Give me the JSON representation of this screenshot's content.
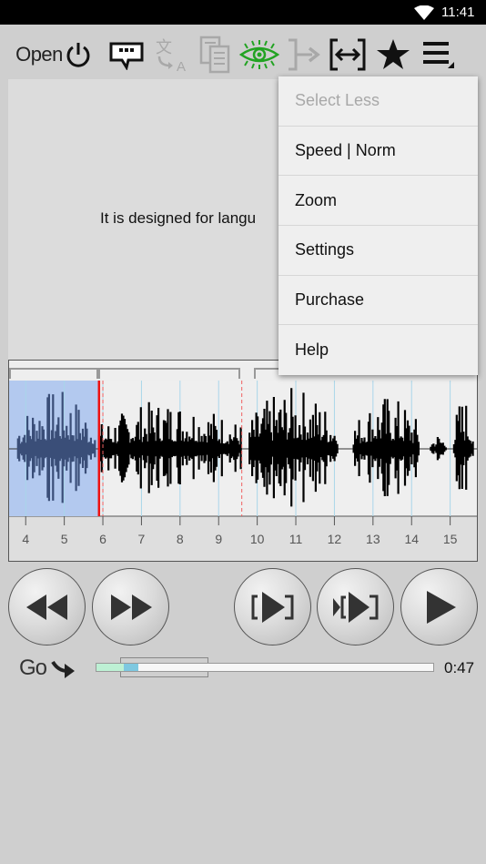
{
  "status_bar": {
    "time": "11:41",
    "wifi_icon": "wifi-icon"
  },
  "toolbar": {
    "open_label": "Open",
    "icons": [
      "power-icon",
      "subtitle-bubble-icon",
      "translate-icon",
      "copy-text-icon",
      "eye-icon",
      "bracket-arrow-icon",
      "expand-selection-icon",
      "star-icon",
      "menu-icon"
    ],
    "colors": {
      "eye": "#22a322",
      "disabled": "#a8a8a8",
      "active": "#111111"
    }
  },
  "text_panel": {
    "sentence": "It is designed for langu"
  },
  "menu": {
    "items": [
      {
        "label": "Select Less",
        "enabled": false
      },
      {
        "label": "Speed | Norm",
        "enabled": true
      },
      {
        "label": "Zoom",
        "enabled": true
      },
      {
        "label": "Settings",
        "enabled": true
      },
      {
        "label": "Purchase",
        "enabled": true
      },
      {
        "label": "Help",
        "enabled": true
      }
    ]
  },
  "waveform": {
    "time_ticks": [
      "4",
      "5",
      "6",
      "7",
      "8",
      "9",
      "10",
      "11",
      "12",
      "13",
      "14",
      "15"
    ],
    "selection_seconds": [
      3.5,
      5.9
    ],
    "playhead_seconds": 5.9,
    "segment_markers_seconds": [
      6.0,
      9.6
    ],
    "colors": {
      "selection": "#b3c9ef",
      "playhead": "#ee1111",
      "wave": "#000000",
      "wave_selected": "#3a4e78"
    }
  },
  "controls": {
    "buttons": [
      "rewind-button",
      "fast-forward-button",
      "play-segment-button",
      "play-from-segment-button",
      "play-button"
    ]
  },
  "go_row": {
    "label": "Go",
    "progress_played_fraction": 0.08,
    "progress_window_fraction": [
      0.08,
      0.125
    ],
    "duration": "0:47"
  }
}
